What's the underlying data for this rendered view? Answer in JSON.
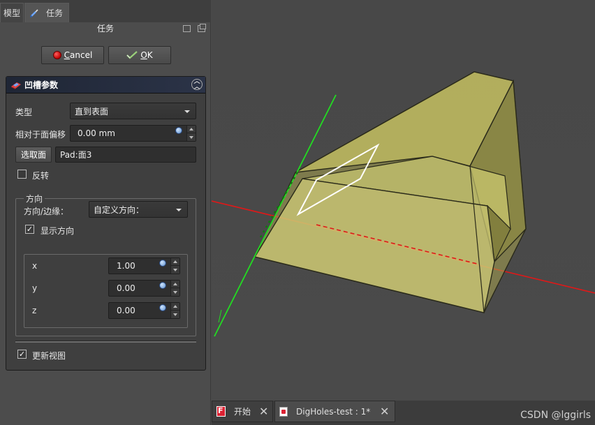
{
  "left_tabs": {
    "model": "模型",
    "task": "任务"
  },
  "panel_title": "任务",
  "buttons": {
    "cancel_prefix": "",
    "cancel_u": "C",
    "cancel_rest": "ancel",
    "ok_u": "O",
    "ok_rest": "K"
  },
  "taskbox": {
    "title": "凹槽参数",
    "type_label": "类型",
    "type_value": "直到表面",
    "offset_label": "相对于面偏移",
    "offset_value": "0.00 mm",
    "select_face_button": "选取面",
    "face_value": "Pad:面3",
    "reverse_label": "反转",
    "reverse_checked": false,
    "direction_group": "方向",
    "direction_edge_label": "方向/边缘：",
    "direction_edge_value": "自定义方向：",
    "show_direction_label": "显示方向",
    "show_direction_checked": true,
    "x_label": "x",
    "x_value": "1.00",
    "y_label": "y",
    "y_value": "0.00",
    "z_label": "z",
    "z_value": "0.00",
    "update_view_label": "更新视图",
    "update_view_checked": true,
    "fx_glyph": "f(x)"
  },
  "doc_tabs": [
    {
      "label": "开始"
    },
    {
      "label": "DigHoles-test : 1*"
    }
  ],
  "watermark": "CSDN @lggirls",
  "colors": {
    "solid_face": "#c8c46a",
    "solid_face_dark": "#9e9a4a",
    "axis_red": "#e01818",
    "axis_green": "#22dd22"
  }
}
